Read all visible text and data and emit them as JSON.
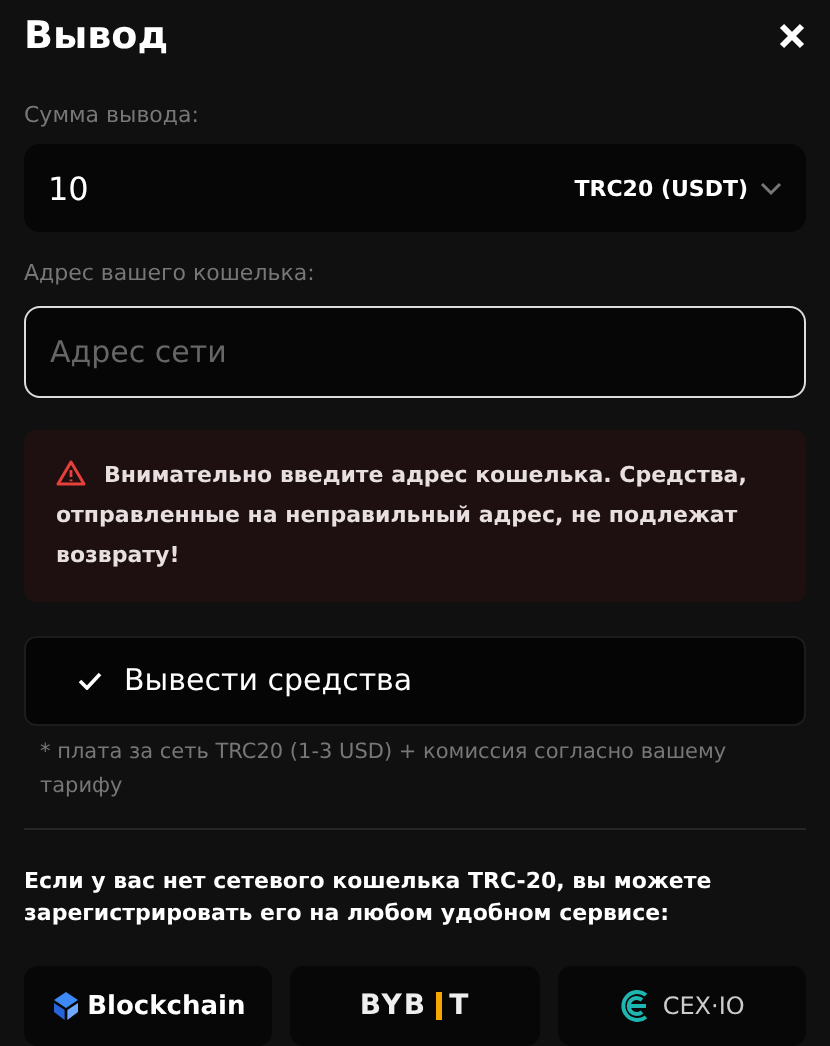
{
  "title": "Вывод",
  "amount": {
    "label": "Сумма вывода:",
    "value": "10",
    "currency": "TRC20 (USDT)"
  },
  "address": {
    "label": "Адрес вашего кошелька:",
    "placeholder": "Адрес сети"
  },
  "warning": "Внимательно введите адрес кошелька. Средства, отправленные на неправильный адрес, не подлежат возврату!",
  "submit": "Вывести средства",
  "note": "* плата за сеть TRC20 (1-3 USD) + комиссия согласно вашему тарифу",
  "info": "Если у вас нет сетевого кошелька TRC-20, вы можете зарегистрировать его на любом удобном сервисе:",
  "services": [
    {
      "kind": "blockchain",
      "text": "Blockchain"
    },
    {
      "kind": "bybit",
      "text": "BYB",
      "text_after": "T"
    },
    {
      "kind": "cex",
      "text": "CEX·IO"
    }
  ]
}
